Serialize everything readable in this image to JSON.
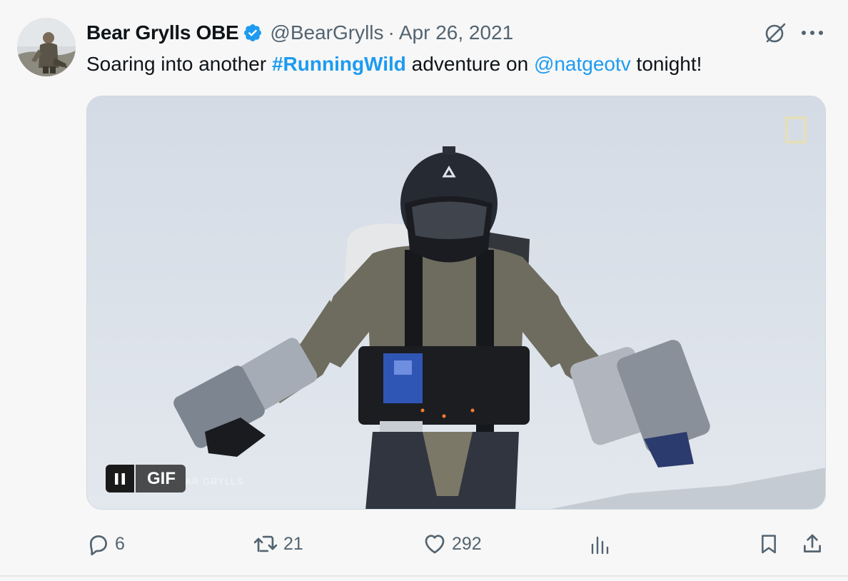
{
  "tweet": {
    "author_name": "Bear Grylls OBE",
    "handle": "@BearGrylls",
    "separator": "·",
    "date": "Apr 26, 2021",
    "text_prefix": "Soaring into another ",
    "hashtag": "#RunningWild",
    "text_middle": " adventure on ",
    "mention": "@natgeotv",
    "text_suffix": " tonight!"
  },
  "media": {
    "badge": "GIF",
    "watermark": "BEAR GRYLLS"
  },
  "actions": {
    "replies": "6",
    "reposts": "21",
    "likes": "292"
  },
  "icons": {
    "verified": "verified-badge-icon",
    "grok": "grok-icon",
    "more": "more-icon",
    "reply": "reply-icon",
    "repost": "repost-icon",
    "like": "heart-icon",
    "views": "analytics-icon",
    "bookmark": "bookmark-icon",
    "share": "share-icon",
    "pause": "pause-icon"
  },
  "colors": {
    "accent": "#1d9bf0",
    "secondary_text": "#536471",
    "text": "#0f1419"
  }
}
